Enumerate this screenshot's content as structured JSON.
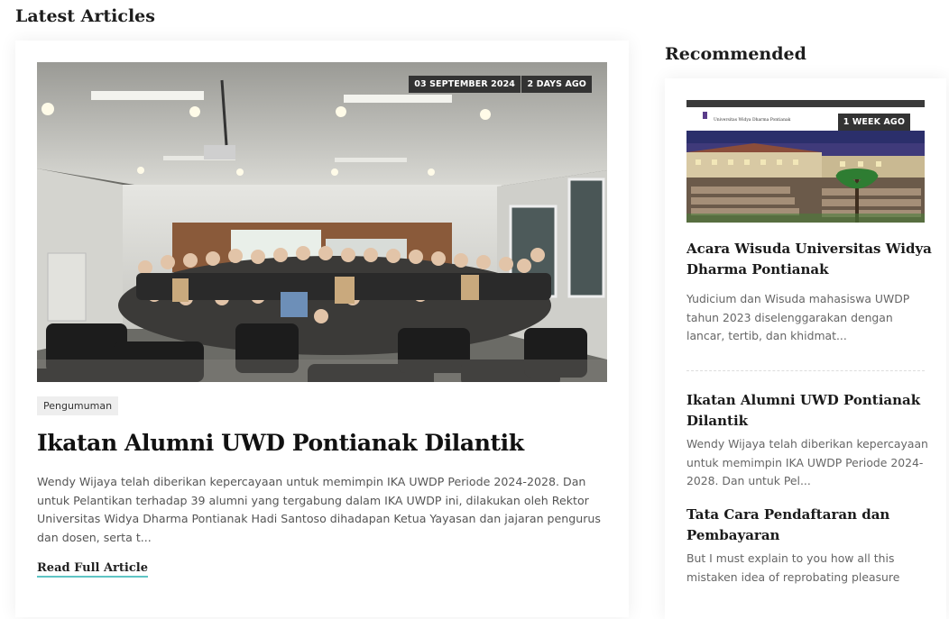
{
  "latest": {
    "title": "Latest Articles",
    "featured": {
      "date": "03 SEPTEMBER 2024",
      "ago": "2 DAYS AGO",
      "category": "Pengumuman",
      "title": "Ikatan Alumni UWD Pontianak Dilantik",
      "excerpt": "Wendy Wijaya telah diberikan kepercayaan untuk memimpin IKA UWDP Periode 2024-2028. Dan untuk Pelantikan terhadap 39 alumni yang tergabung dalam IKA UWDP ini, dilakukan oleh Rektor Universitas Widya Dharma Pontianak Hadi Santoso dihadapan Ketua Yayasan dan jajaran pengurus dan dosen, serta t...",
      "read_more": "Read Full Article",
      "image_icon": "group-photo-classroom"
    }
  },
  "recommended": {
    "title": "Recommended",
    "items": [
      {
        "ago": "1 WEEK AGO",
        "title": "Acara Wisuda Universitas Widya Dharma Pontianak",
        "excerpt": "Yudicium dan Wisuda mahasiswa UWDP tahun 2023 diselenggarakan dengan lancar, tertib, dan khidmat...",
        "site_name": "Universitas Widya Dharma Pontianak",
        "image_icon": "graduation-ceremony-screenshot"
      },
      {
        "title": "Ikatan Alumni UWD Pontianak Dilantik",
        "excerpt": "Wendy Wijaya telah diberikan kepercayaan untuk memimpin IKA UWDP Periode 2024-2028. Dan untuk Pel..."
      },
      {
        "title": "Tata Cara Pendaftaran dan Pembayaran",
        "excerpt": "But I must explain to you how all this mistaken idea of reprobating pleasure"
      }
    ]
  },
  "colors": {
    "badge_bg": "#333333",
    "tag_bg": "#eeeeee",
    "link_underline": "#5ec4c4"
  }
}
